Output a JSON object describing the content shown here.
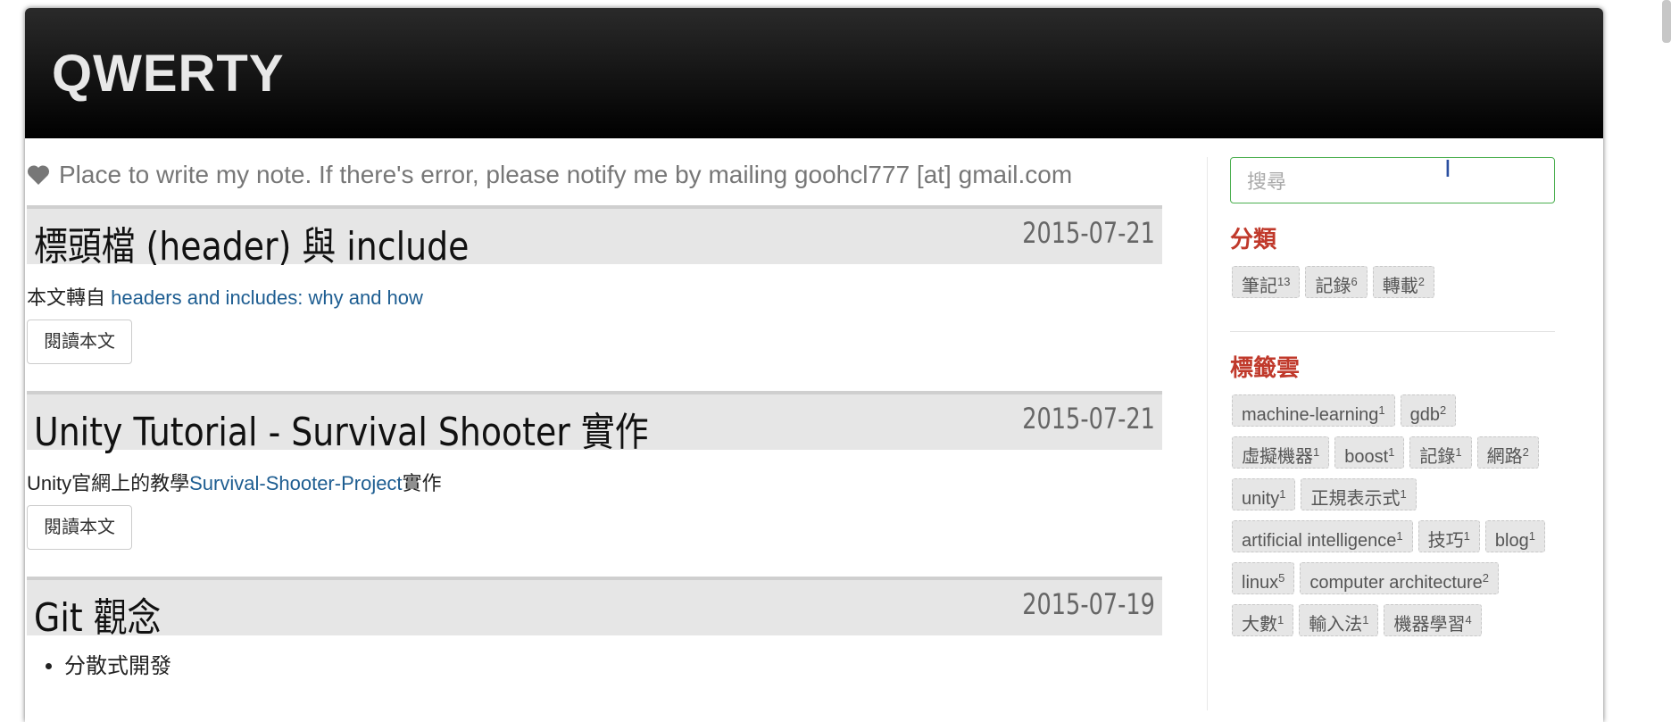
{
  "site": {
    "title": "QWERTY"
  },
  "tagline": "Place to write my note. If there's error, please notify me by mailing goohcl777 [at] gmail.com",
  "posts": [
    {
      "title": "標頭檔 (header) 與 include",
      "date": "2015-07-21",
      "excerpt_prefix": "本文轉自 ",
      "excerpt_link": "headers and includes: why and how",
      "excerpt_suffix": "",
      "read_label": "閱讀本文"
    },
    {
      "title": "Unity Tutorial - Survival Shooter 實作",
      "date": "2015-07-21",
      "excerpt_prefix": "Unity官網上的教學",
      "excerpt_link": "Survival-Shooter-Project",
      "excerpt_suffix": "實作",
      "read_label": "閱讀本文"
    },
    {
      "title": "Git 觀念",
      "date": "2015-07-19",
      "bullets": [
        "分散式開發"
      ]
    }
  ],
  "sidebar": {
    "search_placeholder": "搜尋",
    "categories_title": "分類",
    "categories": [
      {
        "name": "筆記",
        "count": "13"
      },
      {
        "name": "記錄",
        "count": "6"
      },
      {
        "name": "轉載",
        "count": "2"
      }
    ],
    "tags_title": "標籤雲",
    "tags": [
      {
        "name": "machine-learning",
        "count": "1"
      },
      {
        "name": "gdb",
        "count": "2"
      },
      {
        "name": "虛擬機器",
        "count": "1"
      },
      {
        "name": "boost",
        "count": "1"
      },
      {
        "name": "記錄",
        "count": "1"
      },
      {
        "name": "網路",
        "count": "2"
      },
      {
        "name": "unity",
        "count": "1"
      },
      {
        "name": "正規表示式",
        "count": "1"
      },
      {
        "name": "artificial intelligence",
        "count": "1"
      },
      {
        "name": "技巧",
        "count": "1"
      },
      {
        "name": "blog",
        "count": "1"
      },
      {
        "name": "linux",
        "count": "5"
      },
      {
        "name": "computer architecture",
        "count": "2"
      },
      {
        "name": "大數",
        "count": "1"
      },
      {
        "name": "輸入法",
        "count": "1"
      },
      {
        "name": "機器學習",
        "count": "4"
      }
    ]
  },
  "icons": {
    "tagline": "heart-icon",
    "cursor": "text-cursor-icon"
  },
  "colors": {
    "accent": "#c0392b",
    "link": "#1d5d91",
    "header_bg": "#000000"
  }
}
